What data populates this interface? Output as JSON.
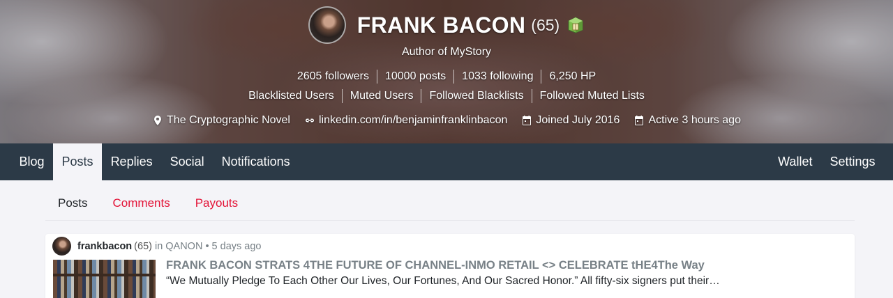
{
  "profile": {
    "display_name": "FRANK BACON",
    "reputation": "(65)",
    "badge_icon": "book-badge-icon",
    "about": "Author of MyStory",
    "stats": {
      "followers": "2605 followers",
      "posts": "10000 posts",
      "following": "1033 following",
      "hp": "6,250 HP"
    },
    "lists": {
      "blacklisted": "Blacklisted Users",
      "muted": "Muted Users",
      "followed_blacklists": "Followed Blacklists",
      "followed_muted": "Followed Muted Lists"
    },
    "meta": {
      "location": "The Cryptographic Novel",
      "website": "linkedin.com/in/benjaminfranklinbacon",
      "joined": "Joined July 2016",
      "active": "Active 3 hours ago"
    }
  },
  "nav": {
    "left": [
      "Blog",
      "Posts",
      "Replies",
      "Social",
      "Notifications"
    ],
    "right": [
      "Wallet",
      "Settings"
    ],
    "active": "Posts"
  },
  "subtabs": {
    "items": [
      "Posts",
      "Comments",
      "Payouts"
    ],
    "active": "Posts"
  },
  "post": {
    "author": "frankbacon",
    "author_rep": "(65)",
    "in_label": "in",
    "community": "QANON",
    "time": "• 5 days ago",
    "title": "FRANK BACON STRATS 4THE FUTURE OF CHANNEL-INMO RETAIL <> CELEBRATE tHE4The Way",
    "excerpt": "“We Mutually Pledge To Each Other Our Lives, Our Fortunes, And Our Sacred Honor.” All fifty-six signers put their…"
  },
  "colors": {
    "nav_bg": "#2c3a47",
    "accent": "#e31337",
    "page_bg": "#f4f4f8"
  }
}
